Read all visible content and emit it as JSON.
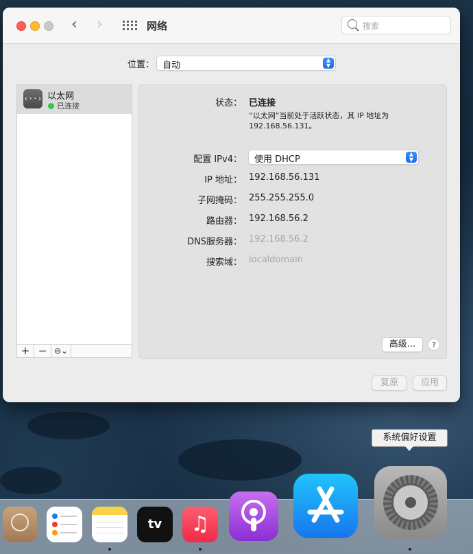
{
  "window": {
    "title": "网络",
    "search_placeholder": "搜索"
  },
  "location": {
    "label": "位置：",
    "value": "自动"
  },
  "sidebar": {
    "services": [
      {
        "name": "以太网",
        "status": "已连接",
        "status_color": "#2dc74a"
      }
    ],
    "toolbar": {
      "add": "+",
      "remove": "−",
      "action": "⊖⌄"
    }
  },
  "detail": {
    "status_label": "状态：",
    "status_value": "已连接",
    "status_desc_line1": "“以太网”当前处于活跃状态，其 IP 地址为",
    "status_desc_line2": "192.168.56.131。",
    "ipv4_label": "配置 IPv4：",
    "ipv4_value": "使用 DHCP",
    "ip_label": "IP 地址：",
    "ip_value": "192.168.56.131",
    "mask_label": "子网掩码：",
    "mask_value": "255.255.255.0",
    "router_label": "路由器：",
    "router_value": "192.168.56.2",
    "dns_label": "DNS服务器：",
    "dns_value": "192.168.56.2",
    "search_domain_label": "搜索域：",
    "search_domain_value": "localdomain",
    "advanced_button": "高级...",
    "help_button": "?"
  },
  "footer": {
    "revert_button": "复原",
    "apply_button": "应用"
  },
  "tooltip": "系统偏好设置",
  "dock": {
    "apps": [
      {
        "name": "contacts-icon",
        "running": false
      },
      {
        "name": "reminders-icon",
        "running": true
      },
      {
        "name": "notes-icon",
        "running": false
      },
      {
        "name": "tv-icon",
        "running": false,
        "label": "tv"
      },
      {
        "name": "music-icon",
        "running": true
      },
      {
        "name": "podcasts-icon",
        "running": false
      },
      {
        "name": "app-store-icon",
        "running": false
      },
      {
        "name": "system-preferences-icon",
        "running": true
      }
    ]
  }
}
